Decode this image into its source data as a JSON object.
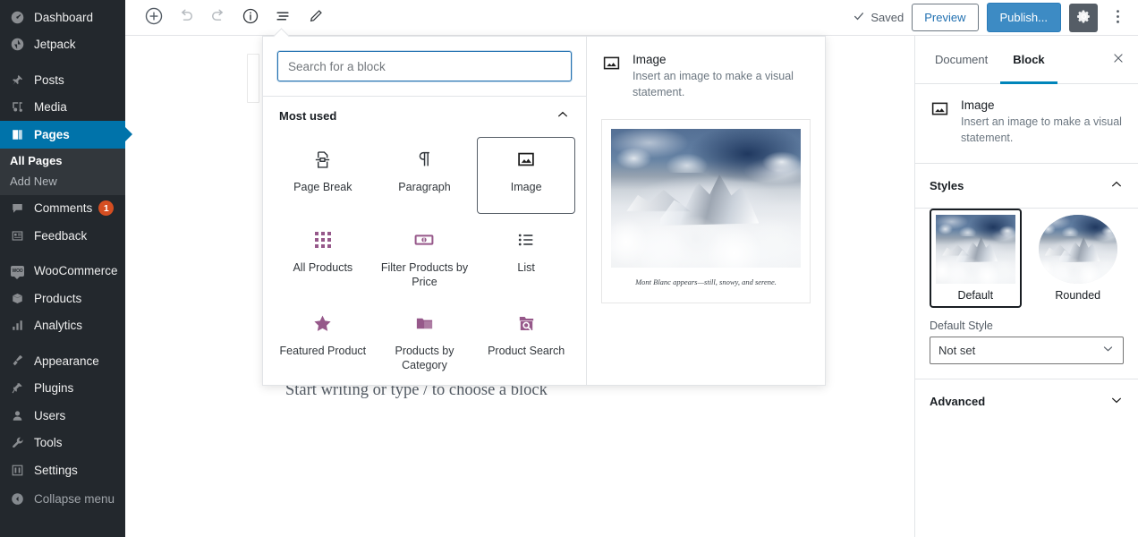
{
  "admin_sidebar": {
    "items": [
      {
        "label": "Dashboard",
        "icon": "dashboard-icon",
        "current": false,
        "gap_before": false
      },
      {
        "label": "Jetpack",
        "icon": "jetpack-icon",
        "current": false,
        "gap_before": false
      },
      {
        "label": "Posts",
        "icon": "pin-icon",
        "current": false,
        "gap_before": true
      },
      {
        "label": "Media",
        "icon": "media-icon",
        "current": false,
        "gap_before": false
      },
      {
        "label": "Pages",
        "icon": "pages-icon",
        "current": true,
        "gap_before": false
      },
      {
        "label": "Comments",
        "icon": "comment-icon",
        "current": false,
        "gap_before": false,
        "badge": "1"
      },
      {
        "label": "Feedback",
        "icon": "feedback-icon",
        "current": false,
        "gap_before": false
      },
      {
        "label": "WooCommerce",
        "icon": "woocommerce-icon",
        "current": false,
        "gap_before": true
      },
      {
        "label": "Products",
        "icon": "box-icon",
        "current": false,
        "gap_before": false
      },
      {
        "label": "Analytics",
        "icon": "chart-bars-icon",
        "current": false,
        "gap_before": false
      },
      {
        "label": "Appearance",
        "icon": "paintbrush-icon",
        "current": false,
        "gap_before": true
      },
      {
        "label": "Plugins",
        "icon": "plug-icon",
        "current": false,
        "gap_before": false
      },
      {
        "label": "Users",
        "icon": "user-icon",
        "current": false,
        "gap_before": false
      },
      {
        "label": "Tools",
        "icon": "wrench-icon",
        "current": false,
        "gap_before": false
      },
      {
        "label": "Settings",
        "icon": "sliders-icon",
        "current": false,
        "gap_before": false
      }
    ],
    "submenu": {
      "after_label": "Pages",
      "items": [
        {
          "label": "All Pages",
          "active": true
        },
        {
          "label": "Add New",
          "active": false
        }
      ]
    },
    "collapse": {
      "label": "Collapse menu",
      "icon": "arrow-left-circle-icon"
    },
    "colors": {
      "background": "#23282d",
      "submenu_background": "#32373c",
      "current": "#0073aa",
      "badge": "#d54e21"
    }
  },
  "topbar": {
    "left_tools": [
      {
        "name": "add-block-button",
        "icon": "plus-circle-icon"
      },
      {
        "name": "undo-button",
        "icon": "undo-icon"
      },
      {
        "name": "redo-button",
        "icon": "redo-icon"
      },
      {
        "name": "content-info-button",
        "icon": "info-circle-icon"
      },
      {
        "name": "list-view-button",
        "icon": "list-view-icon"
      },
      {
        "name": "edit-mode-button",
        "icon": "pencil-icon"
      }
    ],
    "saved_label": "Saved",
    "saved_icon": "check-icon",
    "preview_label": "Preview",
    "publish_label": "Publish...",
    "settings_icon": "gear-icon",
    "more_icon": "kebab-menu-icon",
    "colors": {
      "publish": "#3d8bc4",
      "preview_text": "#2271b1",
      "gear_active": "#555d66"
    }
  },
  "inserter": {
    "search": {
      "value": "",
      "placeholder": "Search for a block"
    },
    "category": {
      "label": "Most used",
      "collapse_icon": "chevron-up-icon",
      "expanded": true
    },
    "blocks": [
      {
        "label": "Page Break",
        "icon": "page-break-icon",
        "selected": false,
        "woo": false
      },
      {
        "label": "Paragraph",
        "icon": "pilcrow-icon",
        "selected": false,
        "woo": false
      },
      {
        "label": "Image",
        "icon": "image-icon",
        "selected": true,
        "woo": false
      },
      {
        "label": "All Products",
        "icon": "grid-dots-icon",
        "selected": false,
        "woo": true
      },
      {
        "label": "Filter Products by Price",
        "icon": "money-icon",
        "selected": false,
        "woo": true
      },
      {
        "label": "List",
        "icon": "bullet-list-icon",
        "selected": false,
        "woo": false
      },
      {
        "label": "Featured Product",
        "icon": "star-icon",
        "selected": false,
        "woo": true
      },
      {
        "label": "Products by Category",
        "icon": "folder-icon",
        "selected": false,
        "woo": true
      },
      {
        "label": "Product Search",
        "icon": "folder-search-icon",
        "selected": false,
        "woo": true
      }
    ],
    "preview": {
      "title": "Image",
      "description": "Insert an image to make a visual statement.",
      "icon": "image-icon",
      "example_caption": "Mont Blanc appears—still, snowy, and serene."
    }
  },
  "canvas": {
    "prompt": "Start writing or type / to choose a block",
    "image_placeholder": {
      "name": "empty-image-block"
    }
  },
  "settings_sidebar": {
    "tabs": [
      {
        "label": "Document",
        "active": false
      },
      {
        "label": "Block",
        "active": true
      }
    ],
    "close_icon": "close-icon",
    "block": {
      "title": "Image",
      "description": "Insert an image to make a visual statement.",
      "icon": "image-icon"
    },
    "styles_panel": {
      "label": "Styles",
      "collapse_icon": "chevron-up-icon",
      "expanded": true,
      "variations": [
        {
          "label": "Default",
          "selected": true,
          "shape": "square"
        },
        {
          "label": "Rounded",
          "selected": false,
          "shape": "round"
        }
      ],
      "default_style": {
        "label": "Default Style",
        "value": "Not set",
        "chevron": "chevron-down-icon"
      }
    },
    "advanced_panel": {
      "label": "Advanced",
      "collapse_icon": "chevron-down-icon",
      "expanded": false
    }
  }
}
